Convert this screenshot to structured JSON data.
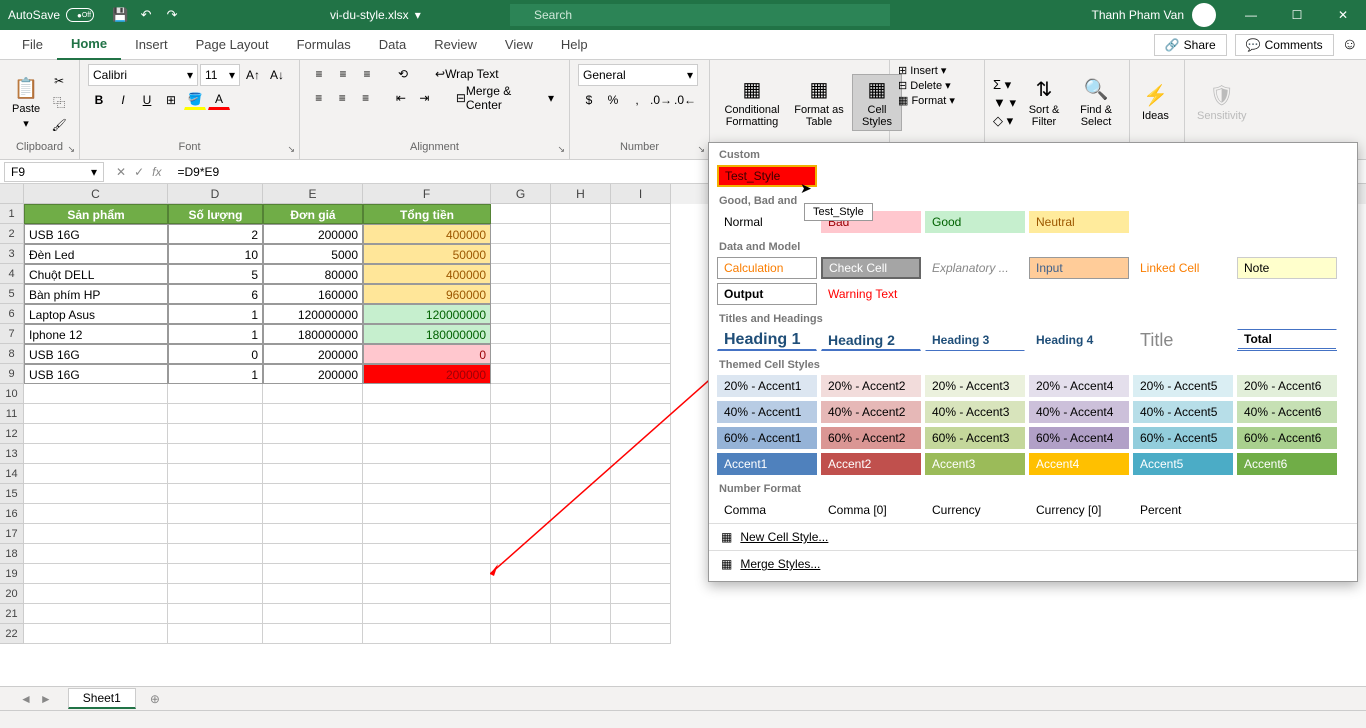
{
  "titlebar": {
    "autosave": "AutoSave",
    "autosave_state": "Off",
    "filename": "vi-du-style.xlsx",
    "search_placeholder": "Search",
    "username": "Thanh Pham Van"
  },
  "tabs": {
    "file": "File",
    "home": "Home",
    "insert": "Insert",
    "pagelayout": "Page Layout",
    "formulas": "Formulas",
    "data": "Data",
    "review": "Review",
    "view": "View",
    "help": "Help",
    "share": "Share",
    "comments": "Comments"
  },
  "ribbon": {
    "paste": "Paste",
    "clipboard": "Clipboard",
    "font_name": "Calibri",
    "font_size": "11",
    "font": "Font",
    "wrap": "Wrap Text",
    "merge": "Merge & Center",
    "alignment": "Alignment",
    "numfmt": "General",
    "number": "Number",
    "condfmt": "Conditional Formatting",
    "fmttable": "Format as Table",
    "cellstyles": "Cell Styles",
    "insert": "Insert",
    "delete": "Delete",
    "format": "Format",
    "sort": "Sort & Filter",
    "find": "Find & Select",
    "ideas": "Ideas",
    "sensitivity": "Sensitivity"
  },
  "formula": {
    "cellref": "F9",
    "formula": "=D9*E9"
  },
  "grid": {
    "cols": [
      "C",
      "D",
      "E",
      "F",
      "G",
      "H",
      "I"
    ],
    "headers": {
      "c": "Sản phẩm",
      "d": "Số lượng",
      "e": "Đơn giá",
      "f": "Tổng tiền"
    },
    "rows": [
      {
        "c": "USB 16G",
        "d": "2",
        "e": "200000",
        "f": "400000",
        "fclass": "f-yellow"
      },
      {
        "c": "Đèn Led",
        "d": "10",
        "e": "5000",
        "f": "50000",
        "fclass": "f-yellow"
      },
      {
        "c": "Chuột DELL",
        "d": "5",
        "e": "80000",
        "f": "400000",
        "fclass": "f-yellow"
      },
      {
        "c": "Bàn phím HP",
        "d": "6",
        "e": "160000",
        "f": "960000",
        "fclass": "f-yellow"
      },
      {
        "c": "Laptop Asus",
        "d": "1",
        "e": "120000000",
        "f": "120000000",
        "fclass": "f-green"
      },
      {
        "c": "Iphone 12",
        "d": "1",
        "e": "180000000",
        "f": "180000000",
        "fclass": "f-green"
      },
      {
        "c": "USB 16G",
        "d": "0",
        "e": "200000",
        "f": "0",
        "fclass": "f-pink"
      },
      {
        "c": "USB 16G",
        "d": "1",
        "e": "200000",
        "f": "200000",
        "fclass": "f-red"
      }
    ]
  },
  "styles_panel": {
    "custom": "Custom",
    "test_style": "Test_Style",
    "tooltip": "Test_Style",
    "gbn": "Good, Bad and",
    "normal": "Normal",
    "bad": "Bad",
    "good": "Good",
    "neutral": "Neutral",
    "dm": "Data and Model",
    "calc": "Calculation",
    "check": "Check Cell",
    "explan": "Explanatory ...",
    "input": "Input",
    "linked": "Linked Cell",
    "note": "Note",
    "output": "Output",
    "warn": "Warning Text",
    "th": "Titles and Headings",
    "h1": "Heading 1",
    "h2": "Heading 2",
    "h3": "Heading 3",
    "h4": "Heading 4",
    "title": "Title",
    "total": "Total",
    "themed": "Themed Cell Styles",
    "accents": {
      "a1": [
        "20% - Accent1",
        "40% - Accent1",
        "60% - Accent1",
        "Accent1"
      ],
      "a2": [
        "20% - Accent2",
        "40% - Accent2",
        "60% - Accent2",
        "Accent2"
      ],
      "a3": [
        "20% - Accent3",
        "40% - Accent3",
        "60% - Accent3",
        "Accent3"
      ],
      "a4": [
        "20% - Accent4",
        "40% - Accent4",
        "60% - Accent4",
        "Accent4"
      ],
      "a5": [
        "20% - Accent5",
        "40% - Accent5",
        "60% - Accent5",
        "Accent5"
      ],
      "a6": [
        "20% - Accent6",
        "40% - Accent6",
        "60% - Accent6",
        "Accent6"
      ]
    },
    "nf": "Number Format",
    "comma": "Comma",
    "comma0": "Comma [0]",
    "currency": "Currency",
    "currency0": "Currency [0]",
    "percent": "Percent",
    "newstyle": "New Cell Style...",
    "mergestyles": "Merge Styles..."
  },
  "sheets": {
    "sheet1": "Sheet1"
  }
}
